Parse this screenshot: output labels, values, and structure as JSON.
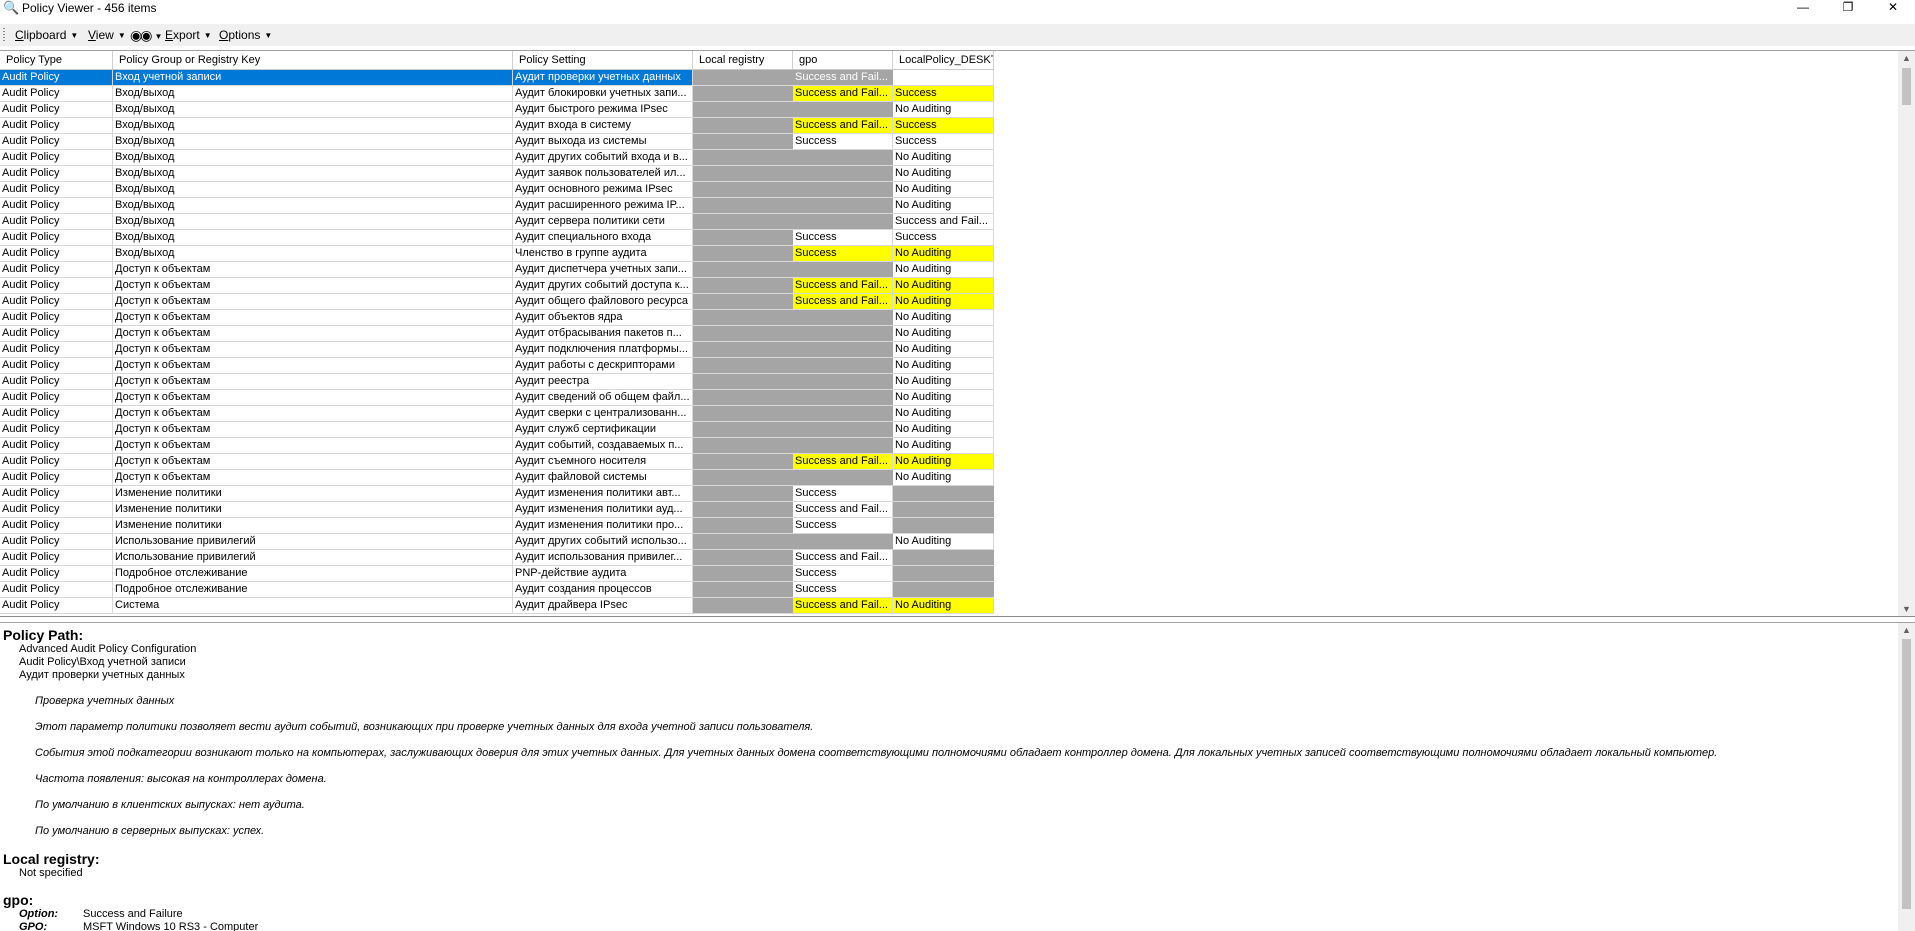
{
  "window": {
    "title": "Policy Viewer - 456 items",
    "minimize": "—",
    "restore": "❐",
    "close": "✕"
  },
  "menu": {
    "clipboard_u": "C",
    "clipboard_rest": "lipboard",
    "view_u": "V",
    "view_rest": "iew",
    "export_u": "E",
    "export_rest": "xport",
    "options_u": "O",
    "options_rest": "ptions",
    "find_icon": "binoculars-icon",
    "caret": "▼"
  },
  "grid": {
    "columns": [
      "Policy Type",
      "Policy Group or Registry Key",
      "Policy Setting",
      "Local registry",
      "gpo",
      "LocalPolicy_DESKT"
    ],
    "rows": [
      [
        "Audit Policy",
        "Вход учетной записи",
        "Аудит проверки учетных данных",
        "",
        "Success and Fail...",
        "",
        "g",
        "w"
      ],
      [
        "Audit Policy",
        "Вход/выход",
        "Аудит блокировки учетных запи...",
        "",
        "Success and Fail...",
        "Success",
        "y",
        "y"
      ],
      [
        "Audit Policy",
        "Вход/выход",
        "Аудит быстрого режима IPsec",
        "",
        "",
        "No Auditing",
        "g",
        "w"
      ],
      [
        "Audit Policy",
        "Вход/выход",
        "Аудит входа в систему",
        "",
        "Success and Fail...",
        "Success",
        "y",
        "y"
      ],
      [
        "Audit Policy",
        "Вход/выход",
        "Аудит выхода из системы",
        "",
        "Success",
        "Success",
        "w",
        "w"
      ],
      [
        "Audit Policy",
        "Вход/выход",
        "Аудит других событий входа и в...",
        "",
        "",
        "No Auditing",
        "g",
        "w"
      ],
      [
        "Audit Policy",
        "Вход/выход",
        "Аудит заявок пользователей ил...",
        "",
        "",
        "No Auditing",
        "g",
        "w"
      ],
      [
        "Audit Policy",
        "Вход/выход",
        "Аудит основного режима IPsec",
        "",
        "",
        "No Auditing",
        "g",
        "w"
      ],
      [
        "Audit Policy",
        "Вход/выход",
        "Аудит расширенного режима IP...",
        "",
        "",
        "No Auditing",
        "g",
        "w"
      ],
      [
        "Audit Policy",
        "Вход/выход",
        "Аудит сервера политики сети",
        "",
        "",
        "Success and Fail...",
        "g",
        "w"
      ],
      [
        "Audit Policy",
        "Вход/выход",
        "Аудит специального входа",
        "",
        "Success",
        "Success",
        "w",
        "w"
      ],
      [
        "Audit Policy",
        "Вход/выход",
        "Членство в группе аудита",
        "",
        "Success",
        "No Auditing",
        "y",
        "y"
      ],
      [
        "Audit Policy",
        "Доступ к объектам",
        "Аудит диспетчера учетных запи...",
        "",
        "",
        "No Auditing",
        "g",
        "w"
      ],
      [
        "Audit Policy",
        "Доступ к объектам",
        "Аудит других событий доступа к...",
        "",
        "Success and Fail...",
        "No Auditing",
        "y",
        "y"
      ],
      [
        "Audit Policy",
        "Доступ к объектам",
        "Аудит общего файлового ресурса",
        "",
        "Success and Fail...",
        "No Auditing",
        "y",
        "y"
      ],
      [
        "Audit Policy",
        "Доступ к объектам",
        "Аудит объектов ядра",
        "",
        "",
        "No Auditing",
        "g",
        "w"
      ],
      [
        "Audit Policy",
        "Доступ к объектам",
        "Аудит отбрасывания пакетов п...",
        "",
        "",
        "No Auditing",
        "g",
        "w"
      ],
      [
        "Audit Policy",
        "Доступ к объектам",
        "Аудит подключения платформы...",
        "",
        "",
        "No Auditing",
        "g",
        "w"
      ],
      [
        "Audit Policy",
        "Доступ к объектам",
        "Аудит работы с дескрипторами",
        "",
        "",
        "No Auditing",
        "g",
        "w"
      ],
      [
        "Audit Policy",
        "Доступ к объектам",
        "Аудит реестра",
        "",
        "",
        "No Auditing",
        "g",
        "w"
      ],
      [
        "Audit Policy",
        "Доступ к объектам",
        "Аудит сведений об общем файл...",
        "",
        "",
        "No Auditing",
        "g",
        "w"
      ],
      [
        "Audit Policy",
        "Доступ к объектам",
        "Аудит сверки с централизованн...",
        "",
        "",
        "No Auditing",
        "g",
        "w"
      ],
      [
        "Audit Policy",
        "Доступ к объектам",
        "Аудит служб сертификации",
        "",
        "",
        "No Auditing",
        "g",
        "w"
      ],
      [
        "Audit Policy",
        "Доступ к объектам",
        "Аудит событий, создаваемых п...",
        "",
        "",
        "No Auditing",
        "g",
        "w"
      ],
      [
        "Audit Policy",
        "Доступ к объектам",
        "Аудит съемного носителя",
        "",
        "Success and Fail...",
        "No Auditing",
        "y",
        "y"
      ],
      [
        "Audit Policy",
        "Доступ к объектам",
        "Аудит файловой системы",
        "",
        "",
        "No Auditing",
        "g",
        "w"
      ],
      [
        "Audit Policy",
        "Изменение политики",
        "Аудит изменения политики авт...",
        "",
        "Success",
        "",
        "w",
        "g"
      ],
      [
        "Audit Policy",
        "Изменение политики",
        "Аудит изменения политики ауд...",
        "",
        "Success and Fail...",
        "",
        "w",
        "g"
      ],
      [
        "Audit Policy",
        "Изменение политики",
        "Аудит изменения политики про...",
        "",
        "Success",
        "",
        "w",
        "g"
      ],
      [
        "Audit Policy",
        "Использование привилегий",
        "Аудит других событий использо...",
        "",
        "",
        "No Auditing",
        "g",
        "w"
      ],
      [
        "Audit Policy",
        "Использование привилегий",
        "Аудит использования привилег...",
        "",
        "Success and Fail...",
        "",
        "w",
        "g"
      ],
      [
        "Audit Policy",
        "Подробное отслеживание",
        "PNP-действие аудита",
        "",
        "Success",
        "",
        "w",
        "g"
      ],
      [
        "Audit Policy",
        "Подробное отслеживание",
        "Аудит создания процессов",
        "",
        "Success",
        "",
        "w",
        "g"
      ],
      [
        "Audit Policy",
        "Система",
        "Аудит драйвера IPsec",
        "",
        "Success and Fail...",
        "No Auditing",
        "y",
        "y"
      ]
    ]
  },
  "details": {
    "policy_path_h": "Policy Path:",
    "path1": "Advanced Audit Policy Configuration",
    "path2": "Audit Policy\\Вход учетной записи",
    "path3": "Аудит проверки учетных данных",
    "d1": "Проверка учетных данных",
    "d2": "Этот параметр политики позволяет вести аудит событий, возникающих при проверке учетных данных для входа учетной записи пользователя.",
    "d3": "События этой подкатегории возникают только на компьютерах, заслуживающих доверия для этих учетных данных. Для учетных данных домена соответствующими полномочиями обладает контроллер домена. Для локальных учетных записей соответствующими полномочиями обладает локальный компьютер.",
    "d4": "Частота появления: высокая на контроллерах домена.",
    "d5": "По умолчанию в клиентских выпусках: нет аудита.",
    "d6": "По умолчанию в серверных выпусках: успех.",
    "local_registry_h": "Local registry:",
    "not_specified": "Not specified",
    "gpo_h": "gpo:",
    "option_k": "Option:",
    "option_v": "Success and Failure",
    "gpo_k": "GPO:",
    "gpo_v": "MSFT Windows 10 RS3 - Computer"
  },
  "colors": {
    "selection": "#0078d7",
    "missing": "#a5a5a5",
    "conflict": "#ffff00"
  }
}
